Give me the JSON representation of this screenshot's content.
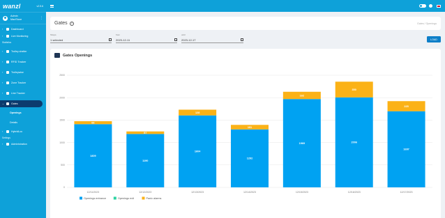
{
  "app": {
    "logo": "wanzl",
    "version": "v2.5.6"
  },
  "user": {
    "name_line1": "Admin",
    "name_line2": "MaxStore",
    "menu_glyph": "⋮"
  },
  "sidebar": {
    "items": [
      {
        "label": "Dashboard",
        "icon": "dashboard-icon"
      },
      {
        "label": "Live Monitoring",
        "icon": "monitor-icon"
      }
    ],
    "section_statistics": "Statistics",
    "stats": [
      {
        "label": "Trolley shelter",
        "icon": "shelter-icon"
      },
      {
        "label": "RFID Tracker",
        "icon": "rfid-icon"
      },
      {
        "label": "Trolleywise",
        "icon": "trolley-icon"
      },
      {
        "label": "Zone Tracker",
        "icon": "zone-icon"
      },
      {
        "label": "Line Tracker",
        "icon": "line-icon"
      },
      {
        "label": "Gates",
        "icon": "gate-icon"
      }
    ],
    "gates_sub": [
      {
        "label": "Openings"
      },
      {
        "label": "Details"
      }
    ],
    "hybrid": {
      "label": "HybridLoc",
      "icon": "lock-icon"
    },
    "section_settings": "Settings",
    "admin": {
      "label": "Administration",
      "icon": "gear-icon"
    }
  },
  "header": {
    "title": "Gates",
    "help": "?",
    "breadcrumb": "Gates / Openings"
  },
  "filters": {
    "shops_label": "Shops",
    "shops_value": "1 selected",
    "from_label": "from",
    "from_value": "2023-12-11",
    "until_label": "until",
    "until_value": "2023-12-17",
    "load_label": "LOAD"
  },
  "chart_title": "Gates Openings",
  "colors": {
    "primary": "#0ea1d9",
    "dark": "#0c3b6e",
    "entrance": "#00a2f2",
    "exit": "#2ed3a2",
    "alarms": "#fbb217"
  },
  "chart_data": {
    "type": "bar",
    "stacked": true,
    "categories": [
      "12/11/2023",
      "12/12/2023",
      "12/13/2023",
      "12/14/2023",
      "12/15/2023",
      "12/16/2023",
      "12/17/2023"
    ],
    "series": [
      {
        "name": "Openings entrance",
        "color": "#00a2f2",
        "values": [
          1409,
          1190,
          1604,
          1292,
          1969,
          2006,
          1697
        ]
      },
      {
        "name": "Openings exit",
        "color": "#2ed3a2",
        "values": [
          0,
          0,
          0,
          0,
          0,
          0,
          0
        ]
      },
      {
        "name": "Panic alarms",
        "color": "#fbb217",
        "values": [
          66,
          57,
          128,
          101,
          162,
          350,
          225
        ]
      }
    ],
    "y_ticks": [
      0,
      500,
      1000,
      1500,
      2000,
      2500
    ],
    "ylim": [
      0,
      2500
    ],
    "grid": true,
    "legend_position": "bottom"
  }
}
